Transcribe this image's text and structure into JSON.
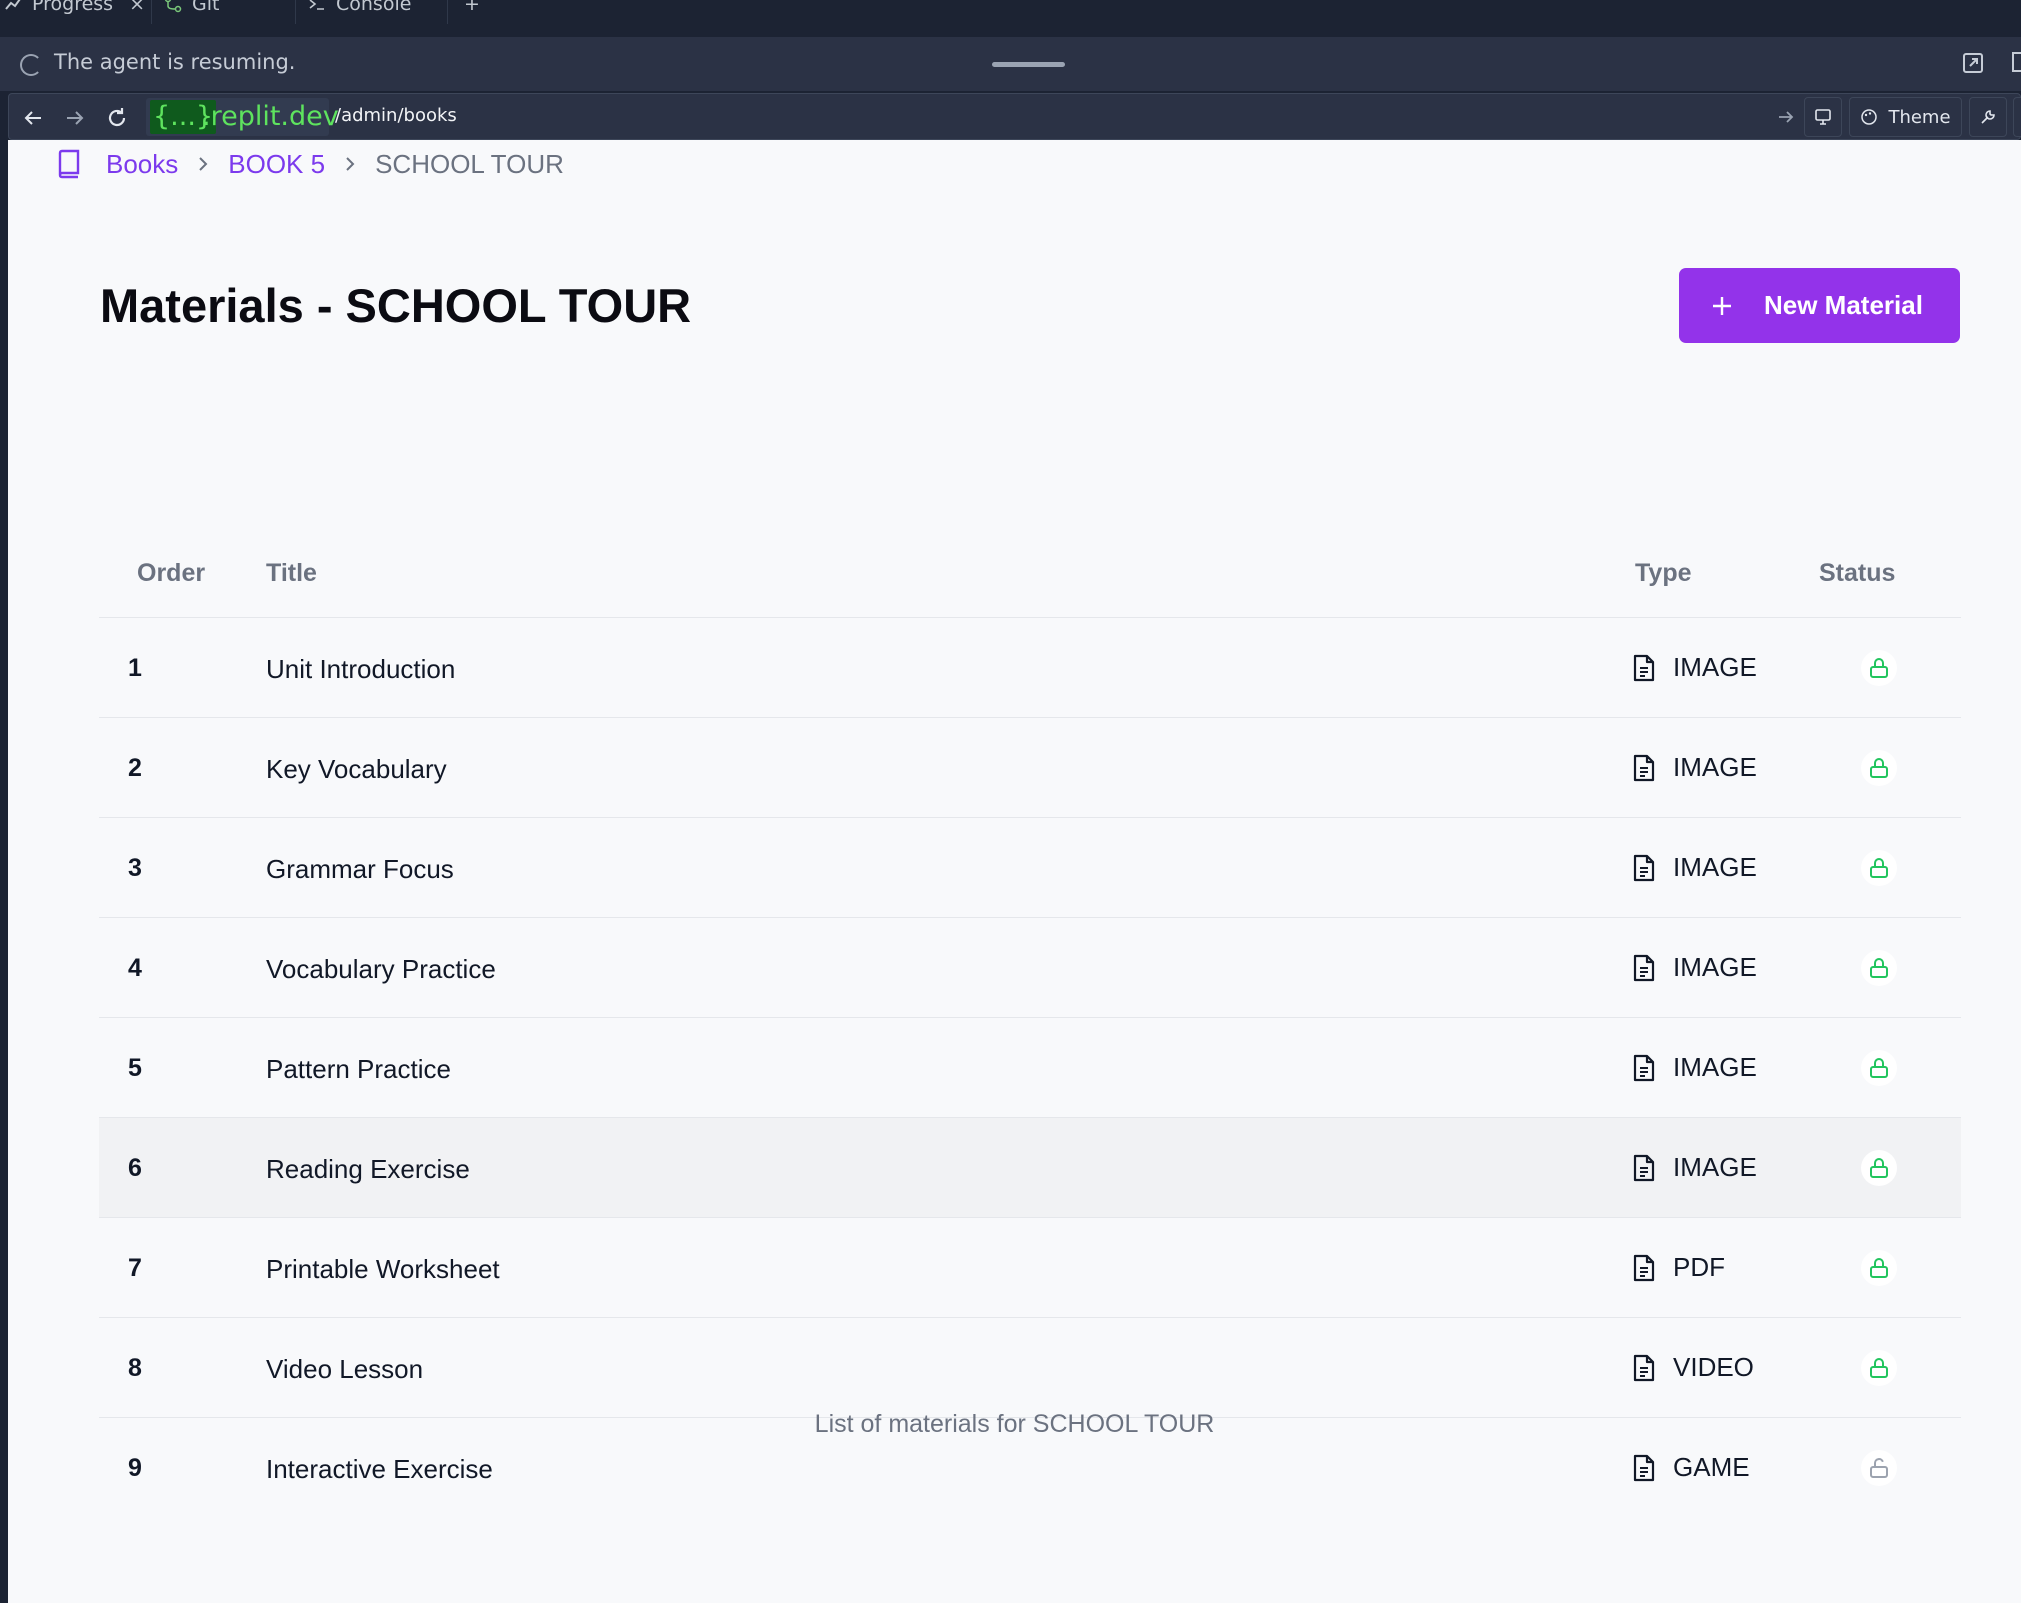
{
  "ide": {
    "tabs": [
      {
        "label": "Progress",
        "icon": "progress-icon"
      },
      {
        "label": "Git",
        "icon": "git-icon"
      },
      {
        "label": "Console",
        "icon": "console-icon"
      }
    ],
    "status_text": "The agent is resuming.",
    "url": {
      "domain_braces": "{...}",
      "domain_rest": ".replit.dev",
      "path": "/admin/books"
    },
    "theme_label": "Theme"
  },
  "breadcrumb": {
    "books": "Books",
    "book": "BOOK 5",
    "current": "SCHOOL TOUR"
  },
  "page": {
    "title": "Materials - SCHOOL TOUR",
    "new_button_label": "New Material",
    "caption": "List of materials for SCHOOL TOUR"
  },
  "table": {
    "headers": {
      "order": "Order",
      "title": "Title",
      "type": "Type",
      "status": "Status"
    },
    "rows": [
      {
        "order": "1",
        "title": "Unit Introduction",
        "type": "IMAGE",
        "status": "locked"
      },
      {
        "order": "2",
        "title": "Key Vocabulary",
        "type": "IMAGE",
        "status": "locked"
      },
      {
        "order": "3",
        "title": "Grammar Focus",
        "type": "IMAGE",
        "status": "locked"
      },
      {
        "order": "4",
        "title": "Vocabulary Practice",
        "type": "IMAGE",
        "status": "locked"
      },
      {
        "order": "5",
        "title": "Pattern Practice",
        "type": "IMAGE",
        "status": "locked"
      },
      {
        "order": "6",
        "title": "Reading Exercise",
        "type": "IMAGE",
        "status": "locked"
      },
      {
        "order": "7",
        "title": "Printable Worksheet",
        "type": "PDF",
        "status": "locked"
      },
      {
        "order": "8",
        "title": "Video Lesson",
        "type": "VIDEO",
        "status": "locked"
      },
      {
        "order": "9",
        "title": "Interactive Exercise",
        "type": "GAME",
        "status": "unlocked"
      }
    ]
  },
  "colors": {
    "accent": "#9333ea",
    "link": "#7c3aed",
    "lock_active": "#22c55e",
    "lock_inactive": "#9ca3af",
    "domain_green": "#5ee35e"
  }
}
